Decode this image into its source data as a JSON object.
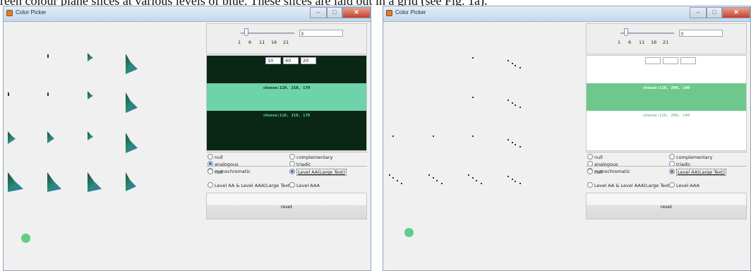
{
  "caption": "reen colour plane slices at various levels of blue. These slices are laid out in a grid (see Fig. 1a).",
  "windows": [
    {
      "title": "Color Picker",
      "slider_ticks": [
        "1",
        "6",
        "11",
        "16",
        "21"
      ],
      "slider_value": "3",
      "rgb_fields": [
        "10",
        "40",
        "20"
      ],
      "choose_top": "choose:110, 210, 170",
      "choose_bottom": "choose:110, 210, 170",
      "colors": {
        "top": "#0a2716",
        "mid": "#6ed2aa",
        "bottom": "#0a2716",
        "choose_top_text": "#0a2716",
        "choose_bottom_text": "#6ed2aa",
        "picked": "#62cc85"
      },
      "scheme_options": [
        {
          "label": "null",
          "checked": false
        },
        {
          "label": "complementary",
          "checked": false
        },
        {
          "label": "analogous",
          "checked": true
        },
        {
          "label": "triadic",
          "checked": false
        },
        {
          "label": "monochromatic",
          "checked": false
        }
      ],
      "contrast_options": [
        {
          "label": "null",
          "checked": false
        },
        {
          "label": "Level AA(Large Text)",
          "checked": true
        },
        {
          "label": "Level AA & Level AAA(Large Text)",
          "checked": false
        },
        {
          "label": "Level AAA",
          "checked": false
        }
      ],
      "reset_label": "reset"
    },
    {
      "title": "Color Picker",
      "slider_ticks": [
        "1",
        "6",
        "11",
        "16",
        "21"
      ],
      "slider_value": "3",
      "rgb_fields": [
        "",
        "",
        ""
      ],
      "choose_top": "choose:110, 200, 140",
      "choose_bottom": "choose:110, 200, 140",
      "colors": {
        "top": "#ffffff",
        "mid": "#6ec88c",
        "bottom": "#ffffff",
        "choose_top_text": "#ffffff",
        "choose_bottom_text": "#6ec88c",
        "picked": "#62cc85"
      },
      "scheme_options": [
        {
          "label": "null",
          "checked": false
        },
        {
          "label": "complementary",
          "checked": false
        },
        {
          "label": "analogous",
          "checked": false
        },
        {
          "label": "triadic",
          "checked": false
        },
        {
          "label": "monochromatic",
          "checked": true
        }
      ],
      "contrast_options": [
        {
          "label": "null",
          "checked": false
        },
        {
          "label": "Level AA(Large Text)",
          "checked": true
        },
        {
          "label": "Level AA & Level AAA(Large Text)",
          "checked": false
        },
        {
          "label": "Level AAA",
          "checked": false
        }
      ],
      "reset_label": "reset"
    }
  ]
}
